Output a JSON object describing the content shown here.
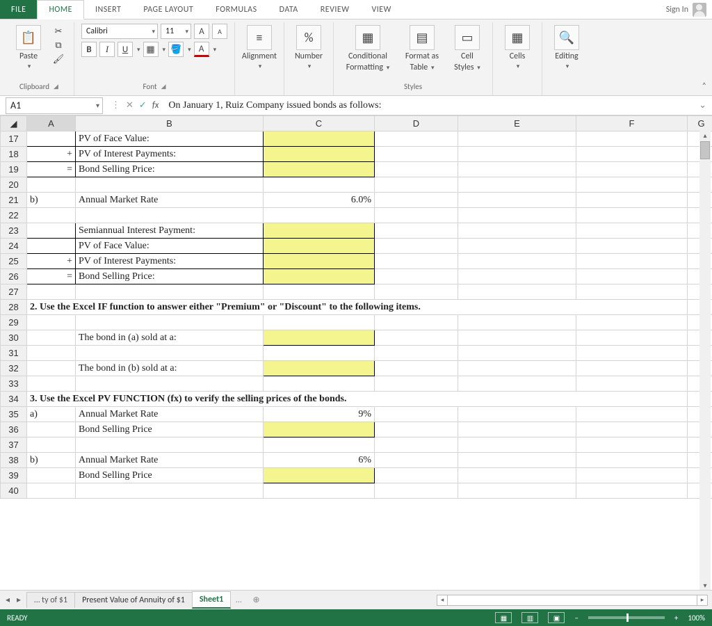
{
  "tabs": {
    "file": "FILE",
    "home": "HOME",
    "insert": "INSERT",
    "pagelayout": "PAGE LAYOUT",
    "formulas": "FORMULAS",
    "data": "DATA",
    "review": "REVIEW",
    "view": "VIEW",
    "signin": "Sign In"
  },
  "ribbon": {
    "clipboard": {
      "paste": "Paste",
      "label": "Clipboard"
    },
    "font": {
      "family": "Calibri",
      "size": "11",
      "bold": "B",
      "italic": "I",
      "underline": "U",
      "label": "Font"
    },
    "alignment": {
      "label": "Alignment"
    },
    "number": {
      "label": "Number",
      "percent": "%"
    },
    "styles": {
      "cond": "Conditional Formatting",
      "cond1": "Conditional",
      "cond2": "Formatting",
      "fmt1": "Format as",
      "fmt2": "Table",
      "cell1": "Cell",
      "cell2": "Styles",
      "label": "Styles"
    },
    "cells": {
      "label": "Cells"
    },
    "editing": {
      "label": "Editing"
    }
  },
  "namebox": "A1",
  "formula": "On January 1,  Ruiz Company issued bonds as follows:",
  "columns": {
    "A": "A",
    "B": "B",
    "C": "C",
    "D": "D",
    "E": "E",
    "F": "F",
    "G": "G"
  },
  "rows": {
    "17": {
      "n": "17",
      "B": "PV of Face Value:"
    },
    "18": {
      "n": "18",
      "A": "+",
      "B": "PV of Interest Payments:"
    },
    "19": {
      "n": "19",
      "A": "=",
      "B": "Bond Selling Price:"
    },
    "20": {
      "n": "20"
    },
    "21": {
      "n": "21",
      "A": "b)",
      "B": "Annual Market Rate",
      "C": "6.0%"
    },
    "22": {
      "n": "22"
    },
    "23": {
      "n": "23",
      "B": "Semiannual Interest Payment:"
    },
    "24": {
      "n": "24",
      "B": "PV of Face Value:"
    },
    "25": {
      "n": "25",
      "A": "+",
      "B": "PV of Interest Payments:"
    },
    "26": {
      "n": "26",
      "A": "=",
      "B": "Bond Selling Price:"
    },
    "27": {
      "n": "27"
    },
    "28": {
      "n": "28",
      "A": "2. Use the Excel IF function to answer either \"Premium\" or \"Discount\" to the following items."
    },
    "29": {
      "n": "29"
    },
    "30": {
      "n": "30",
      "B": "The bond in (a) sold at a:"
    },
    "31": {
      "n": "31"
    },
    "32": {
      "n": "32",
      "B": "The bond in (b) sold at a:"
    },
    "33": {
      "n": "33"
    },
    "34": {
      "n": "34",
      "A": "3.  Use the Excel PV FUNCTION (fx) to verify the selling prices of the bonds."
    },
    "35": {
      "n": "35",
      "A": "a)",
      "B": "Annual Market Rate",
      "C": "9%"
    },
    "36": {
      "n": "36",
      "B": "Bond Selling Price"
    },
    "37": {
      "n": "37"
    },
    "38": {
      "n": "38",
      "A": "b)",
      "B": "Annual Market Rate",
      "C": "6%"
    },
    "39": {
      "n": "39",
      "B": "Bond Selling Price"
    },
    "40": {
      "n": "40"
    }
  },
  "sheets": {
    "trunc": "…  ty of $1",
    "s2": "Present Value of Annuity of $1",
    "active": "Sheet1",
    "more": "…"
  },
  "status": {
    "ready": "READY",
    "zoom": "100%",
    "minus": "–",
    "plus": "+"
  }
}
